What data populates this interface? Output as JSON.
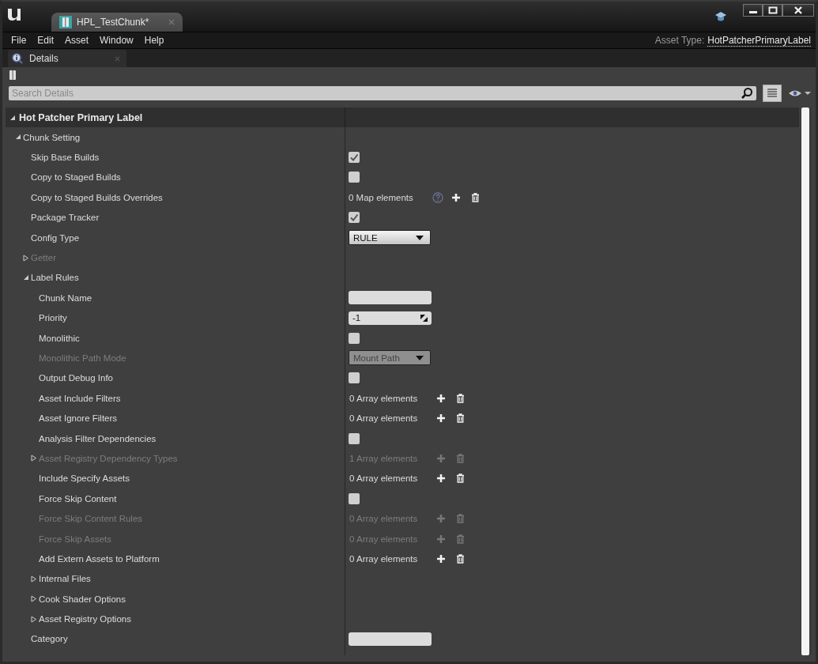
{
  "window": {
    "tab": {
      "label": "HPL_TestChunk*"
    }
  },
  "menu": [
    "File",
    "Edit",
    "Asset",
    "Window",
    "Help"
  ],
  "asset_type": {
    "label": "Asset Type:",
    "value": "HotPatcherPrimaryLabel"
  },
  "panel_tab": {
    "label": "Details"
  },
  "search": {
    "placeholder": "Search Details"
  },
  "category": {
    "label": "Hot Patcher Primary Label",
    "expanded": true
  },
  "rows": [
    {
      "label": "Chunk Setting",
      "kind": "group",
      "disabled": false,
      "expanded": true,
      "children": [
        {
          "label": "Skip Base Builds",
          "kind": "checkbox",
          "disabled": false,
          "checked": true
        },
        {
          "label": "Copy to Staged Builds",
          "kind": "checkbox",
          "disabled": false,
          "checked": false
        },
        {
          "label": "Copy to Staged Builds Overrides",
          "kind": "map",
          "disabled": false,
          "value": "0 Map elements"
        },
        {
          "label": "Package Tracker",
          "kind": "checkbox",
          "disabled": false,
          "checked": true
        },
        {
          "label": "Config Type",
          "kind": "combo",
          "disabled": false,
          "value": "RULE"
        },
        {
          "label": "Getter",
          "kind": "group",
          "disabled": true,
          "expanded": false
        },
        {
          "label": "Label Rules",
          "kind": "group",
          "disabled": false,
          "expanded": true,
          "children": [
            {
              "label": "Chunk Name",
              "kind": "text",
              "disabled": false
            },
            {
              "label": "Priority",
              "kind": "number",
              "disabled": false,
              "value": "-1"
            },
            {
              "label": "Monolithic",
              "kind": "checkbox",
              "disabled": false,
              "checked": false
            },
            {
              "label": "Monolithic Path Mode",
              "kind": "combo",
              "disabled": true,
              "value": "Mount Path"
            },
            {
              "label": "Output Debug Info",
              "kind": "checkbox",
              "disabled": false,
              "checked": false
            },
            {
              "label": "Asset Include Filters",
              "kind": "array",
              "disabled": false,
              "value": "0 Array elements"
            },
            {
              "label": "Asset Ignore Filters",
              "kind": "array",
              "disabled": false,
              "value": "0 Array elements"
            },
            {
              "label": "Analysis Filter Dependencies",
              "kind": "checkbox",
              "disabled": false,
              "checked": false
            },
            {
              "label": "Asset Registry Dependency Types",
              "kind": "array",
              "disabled": true,
              "expanded": false,
              "value": "1 Array elements"
            },
            {
              "label": "Include Specify Assets",
              "kind": "array",
              "disabled": false,
              "value": "0 Array elements"
            },
            {
              "label": "Force Skip Content",
              "kind": "checkbox",
              "disabled": false,
              "checked": false
            },
            {
              "label": "Force Skip Content Rules",
              "kind": "array",
              "disabled": true,
              "value": "0 Array elements"
            },
            {
              "label": "Force Skip Assets",
              "kind": "array",
              "disabled": true,
              "value": "0 Array elements"
            },
            {
              "label": "Add Extern Assets to Platform",
              "kind": "array",
              "disabled": false,
              "value": "0 Array elements"
            },
            {
              "label": "Internal Files",
              "kind": "group",
              "disabled": false,
              "expanded": false
            },
            {
              "label": "Cook Shader Options",
              "kind": "group",
              "disabled": false,
              "expanded": false
            },
            {
              "label": "Asset Registry Options",
              "kind": "group",
              "disabled": false,
              "expanded": false
            }
          ]
        },
        {
          "label": "Category",
          "kind": "text",
          "disabled": false
        }
      ]
    }
  ]
}
